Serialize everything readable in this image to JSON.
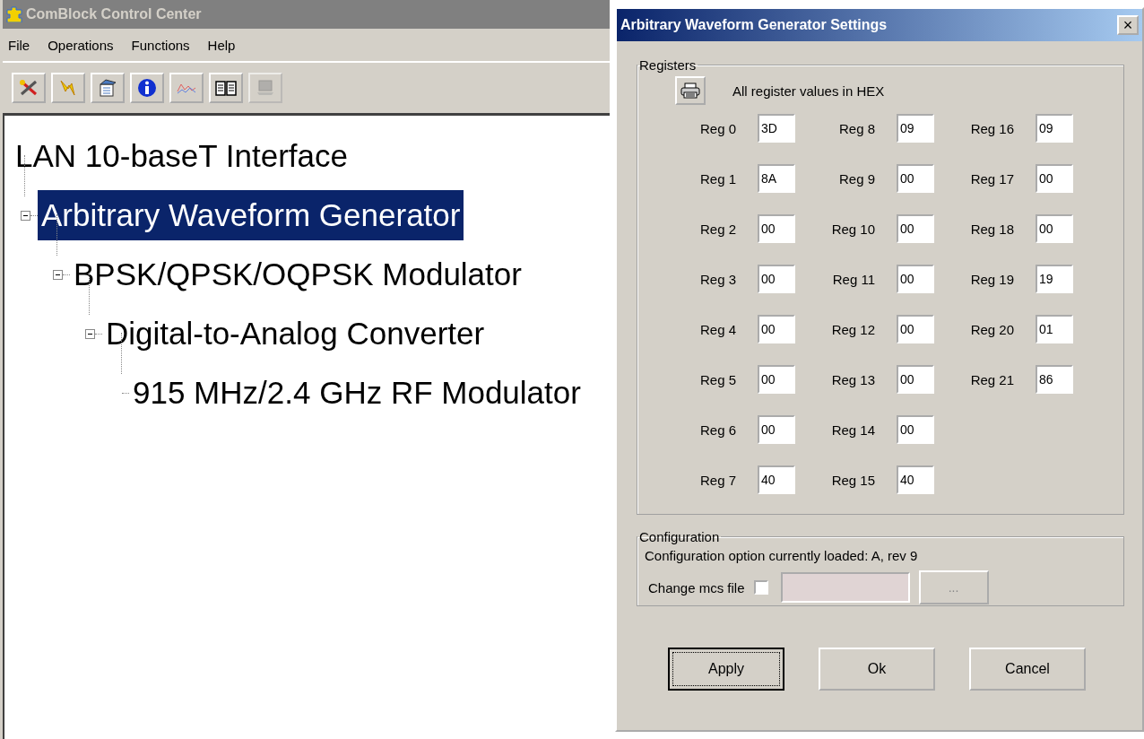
{
  "main_window": {
    "title": "ComBlock Control Center",
    "menu": [
      "File",
      "Operations",
      "Functions",
      "Help"
    ],
    "toolbar": [
      {
        "kind": "tools",
        "disabled": false
      },
      {
        "kind": "lightning",
        "disabled": false
      },
      {
        "kind": "properties",
        "disabled": false
      },
      {
        "kind": "info",
        "disabled": false
      },
      {
        "kind": "chart",
        "disabled": false
      },
      {
        "kind": "book",
        "disabled": false
      },
      {
        "kind": "computer",
        "disabled": true
      }
    ],
    "tree": [
      {
        "label": "LAN 10-baseT Interface",
        "selected": false,
        "children": [
          {
            "label": "Arbitrary Waveform Generator",
            "selected": true,
            "expanded": true,
            "children": [
              {
                "label": "BPSK/QPSK/OQPSK Modulator",
                "selected": false,
                "expanded": true,
                "children": [
                  {
                    "label": "Digital-to-Analog Converter",
                    "selected": false,
                    "expanded": true,
                    "children": [
                      {
                        "label": "915 MHz/2.4 GHz RF Modulator",
                        "selected": false
                      }
                    ]
                  }
                ]
              }
            ]
          }
        ]
      }
    ]
  },
  "dialog": {
    "title": "Arbitrary Waveform Generator Settings",
    "close": "×",
    "registers": {
      "legend": "Registers",
      "note": "All register values in HEX",
      "columns": [
        [
          {
            "label": "Reg 0",
            "value": "3D"
          },
          {
            "label": "Reg 1",
            "value": "8A"
          },
          {
            "label": "Reg 2",
            "value": "00"
          },
          {
            "label": "Reg 3",
            "value": "00"
          },
          {
            "label": "Reg 4",
            "value": "00"
          },
          {
            "label": "Reg 5",
            "value": "00"
          },
          {
            "label": "Reg 6",
            "value": "00"
          },
          {
            "label": "Reg 7",
            "value": "40"
          }
        ],
        [
          {
            "label": "Reg 8",
            "value": "09"
          },
          {
            "label": "Reg 9",
            "value": "00"
          },
          {
            "label": "Reg 10",
            "value": "00"
          },
          {
            "label": "Reg 11",
            "value": "00"
          },
          {
            "label": "Reg 12",
            "value": "00"
          },
          {
            "label": "Reg 13",
            "value": "00"
          },
          {
            "label": "Reg 14",
            "value": "00"
          },
          {
            "label": "Reg 15",
            "value": "40"
          }
        ],
        [
          {
            "label": "Reg 16",
            "value": "09"
          },
          {
            "label": "Reg 17",
            "value": "00"
          },
          {
            "label": "Reg 18",
            "value": "00"
          },
          {
            "label": "Reg 19",
            "value": "19"
          },
          {
            "label": "Reg 20",
            "value": "01"
          },
          {
            "label": "Reg 21",
            "value": "86"
          }
        ]
      ]
    },
    "configuration": {
      "legend": "Configuration",
      "status": "Configuration option currently loaded: A, rev 9",
      "change_label": "Change mcs file",
      "checked": false,
      "file_field_disabled": true,
      "browse": "..."
    },
    "buttons": [
      {
        "label": "Apply",
        "focused": true
      },
      {
        "label": "Ok",
        "focused": false
      },
      {
        "label": "Cancel",
        "focused": false
      }
    ]
  }
}
